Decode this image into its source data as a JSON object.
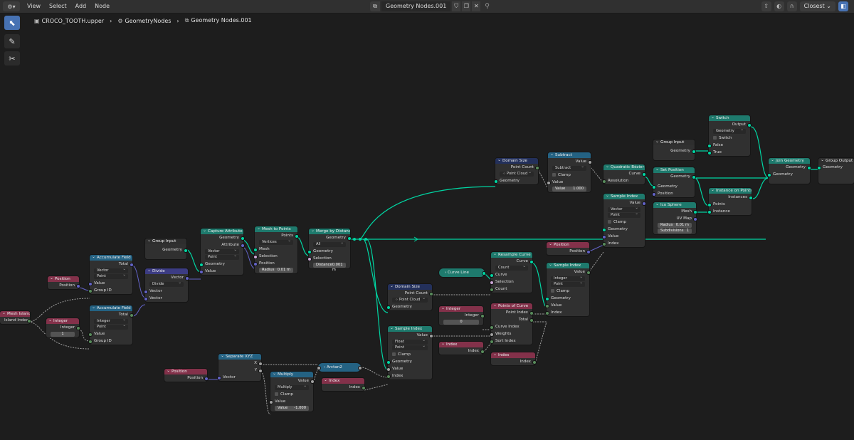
{
  "header": {
    "menus": [
      "View",
      "Select",
      "Add",
      "Node"
    ],
    "node_tree": "Geometry Nodes.001",
    "snap_mode": "Closest"
  },
  "breadcrumb": {
    "object": "CROCO_TOOTH.upper",
    "modifier": "GeometryNodes",
    "tree": "Geometry Nodes.001"
  },
  "nodes": {
    "mesh_island": {
      "title": "Mesh Island",
      "out": "Island Index"
    },
    "position1": {
      "title": "Position",
      "out": "Position"
    },
    "integer1": {
      "title": "Integer",
      "out": "Integer",
      "value": "1"
    },
    "acc1": {
      "title": "Accumulate Field",
      "out": "Total",
      "dtype": "Vector",
      "domain": "Point",
      "in_value": "Value",
      "in_group": "Group ID"
    },
    "acc2": {
      "title": "Accumulate Field",
      "out": "Total",
      "dtype": "Integer",
      "domain": "Point",
      "in_value": "Value",
      "in_group": "Group ID"
    },
    "group_input1": {
      "title": "Group Input",
      "out": "Geometry"
    },
    "divide": {
      "title": "Divide",
      "out": "Vector",
      "op": "Divide",
      "in_a": "Vector",
      "in_b": "Vector"
    },
    "capture": {
      "title": "Capture Attribute",
      "out_geo": "Geometry",
      "out_attr": "Attribute",
      "dtype": "Vector",
      "domain": "Point",
      "in_geo": "Geometry",
      "in_val": "Value"
    },
    "mesh_to_points": {
      "title": "Mesh to Points",
      "out": "Points",
      "mode": "Vertices",
      "in_mesh": "Mesh",
      "in_sel": "Selection",
      "in_pos": "Position",
      "radius_label": "Radius",
      "radius_value": "0.01 m"
    },
    "merge": {
      "title": "Merge by Distance",
      "out": "Geometry",
      "mode": "All",
      "in_geo": "Geometry",
      "in_sel": "Selection",
      "dist_label": "Distance",
      "dist_value": "0.001 m"
    },
    "domain_size1": {
      "title": "Domain Size",
      "out": "Point Count",
      "comp": "Point Cloud",
      "in_geo": "Geometry"
    },
    "subtract": {
      "title": "Subtract",
      "out": "Value",
      "op": "Subtract",
      "clamp": "Clamp",
      "in_val": "Value",
      "val_label": "Value",
      "val_value": "1.000"
    },
    "quad_bezier": {
      "title": "Quadratic Bézier",
      "out": "Curve",
      "in_res": "Resolution"
    },
    "sample_index1": {
      "title": "Sample Index",
      "out": "Value",
      "dtype": "Vector",
      "domain": "Point",
      "clamp": "Clamp",
      "in_geo": "Geometry",
      "in_val": "Value",
      "in_idx": "Index"
    },
    "group_input2": {
      "title": "Group Input",
      "out": "Geometry"
    },
    "switch": {
      "title": "Switch",
      "out": "Output",
      "dtype": "Geometry",
      "in_switch": "Switch",
      "in_false": "False",
      "in_true": "True"
    },
    "set_position": {
      "title": "Set Position",
      "out": "Geometry",
      "in_geo": "Geometry",
      "in_pos": "Position"
    },
    "instance_on_points": {
      "title": "Instance on Points",
      "out": "Instances",
      "in_points": "Points",
      "in_inst": "Instance"
    },
    "ico_sphere": {
      "title": "Ico Sphere",
      "out_mesh": "Mesh",
      "out_uv": "UV Map",
      "radius_label": "Radius",
      "radius_value": "0.01 m",
      "sub_label": "Subdivisions",
      "sub_value": "1"
    },
    "join": {
      "title": "Join Geometry",
      "out": "Geometry",
      "in_geo": "Geometry"
    },
    "group_output": {
      "title": "Group Output",
      "in_geo": "Geometry"
    },
    "position2": {
      "title": "Position",
      "out": "Position"
    },
    "resample": {
      "title": "Resample Curve",
      "out": "Curve",
      "mode": "Count",
      "in_curve": "Curve",
      "in_sel": "Selection",
      "in_count": "Count"
    },
    "curve_line": {
      "title": "Curve Line"
    },
    "domain_size2": {
      "title": "Domain Size",
      "out": "Point Count",
      "comp": "Point Cloud",
      "in_geo": "Geometry"
    },
    "integer2": {
      "title": "Integer",
      "out": "Integer",
      "value": "0"
    },
    "points_of_curve": {
      "title": "Points of Curve",
      "out_idx": "Point Index",
      "out_total": "Total",
      "in_ci": "Curve Index",
      "in_w": "Weights",
      "in_sort": "Sort Index"
    },
    "sample_index2": {
      "title": "Sample Index",
      "out": "Value",
      "dtype": "Integer",
      "domain": "Point",
      "clamp": "Clamp",
      "in_geo": "Geometry",
      "in_val": "Value",
      "in_idx": "Index"
    },
    "index1": {
      "title": "Index",
      "out": "Index"
    },
    "index2": {
      "title": "Index",
      "out": "Index"
    },
    "sample_index3": {
      "title": "Sample Index",
      "out": "Value",
      "dtype": "Float",
      "domain": "Point",
      "clamp": "Clamp",
      "in_geo": "Geometry",
      "in_val": "Value",
      "in_idx": "Index"
    },
    "position3": {
      "title": "Position",
      "out": "Position",
      "in_vec": "Vector"
    },
    "separate_xyz": {
      "title": "Separate XYZ",
      "out_x": "X",
      "out_y": "Y",
      "in_vec": "Vector"
    },
    "multiply": {
      "title": "Multiply",
      "out": "Value",
      "op": "Multiply",
      "clamp": "Clamp",
      "in_val": "Value",
      "val_label": "Value",
      "val_value": "-1.000"
    },
    "arctan2": {
      "title": "Arctan2"
    },
    "index3": {
      "title": "Index",
      "out": "Index"
    }
  }
}
